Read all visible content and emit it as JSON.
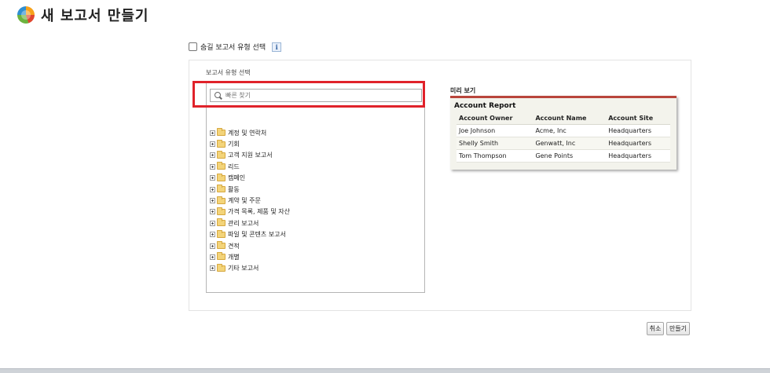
{
  "header": {
    "title": "새 보고서 만들기",
    "logo_icon": "salesforce-logo"
  },
  "hidden_types": {
    "label": "숨길 보고서 유형 선택",
    "checked": false,
    "info_label": "i"
  },
  "report_types": {
    "section_label": "보고서 유형 선택",
    "search_placeholder": "빠른 찾기",
    "folders": [
      "계정 및 연락처",
      "기회",
      "고객 지원 보고서",
      "리드",
      "캠페인",
      "활동",
      "계약 및 주문",
      "가격 목록, 제품 및 자산",
      "관리 보고서",
      "파일 및 콘텐츠 보고서",
      "견적",
      "개별",
      "기타 보고서"
    ]
  },
  "preview": {
    "label": "미리 보기",
    "report_title": "Account Report",
    "columns": [
      "Account  Owner",
      "Account Name",
      "Account Site"
    ],
    "rows": [
      [
        "Joe Johnson",
        "Acme, Inc",
        "Headquarters"
      ],
      [
        "Shelly Smith",
        "Genwatt, Inc",
        "Headquarters"
      ],
      [
        "Tom Thompson",
        "Gene Points",
        "Headquarters"
      ]
    ]
  },
  "buttons": {
    "cancel": "취소",
    "create": "만들기"
  }
}
